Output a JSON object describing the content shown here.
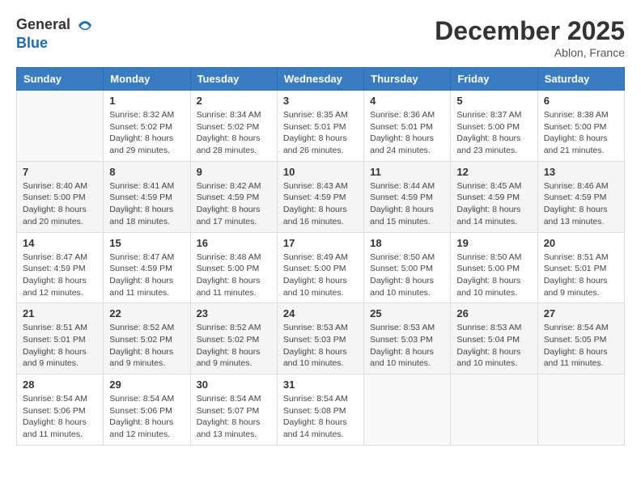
{
  "logo": {
    "general": "General",
    "blue": "Blue"
  },
  "header": {
    "month_year": "December 2025",
    "location": "Ablon, France"
  },
  "weekdays": [
    "Sunday",
    "Monday",
    "Tuesday",
    "Wednesday",
    "Thursday",
    "Friday",
    "Saturday"
  ],
  "weeks": [
    [
      {
        "day": "",
        "info": ""
      },
      {
        "day": "1",
        "info": "Sunrise: 8:32 AM\nSunset: 5:02 PM\nDaylight: 8 hours\nand 29 minutes."
      },
      {
        "day": "2",
        "info": "Sunrise: 8:34 AM\nSunset: 5:02 PM\nDaylight: 8 hours\nand 28 minutes."
      },
      {
        "day": "3",
        "info": "Sunrise: 8:35 AM\nSunset: 5:01 PM\nDaylight: 8 hours\nand 26 minutes."
      },
      {
        "day": "4",
        "info": "Sunrise: 8:36 AM\nSunset: 5:01 PM\nDaylight: 8 hours\nand 24 minutes."
      },
      {
        "day": "5",
        "info": "Sunrise: 8:37 AM\nSunset: 5:00 PM\nDaylight: 8 hours\nand 23 minutes."
      },
      {
        "day": "6",
        "info": "Sunrise: 8:38 AM\nSunset: 5:00 PM\nDaylight: 8 hours\nand 21 minutes."
      }
    ],
    [
      {
        "day": "7",
        "info": "Sunrise: 8:40 AM\nSunset: 5:00 PM\nDaylight: 8 hours\nand 20 minutes."
      },
      {
        "day": "8",
        "info": "Sunrise: 8:41 AM\nSunset: 4:59 PM\nDaylight: 8 hours\nand 18 minutes."
      },
      {
        "day": "9",
        "info": "Sunrise: 8:42 AM\nSunset: 4:59 PM\nDaylight: 8 hours\nand 17 minutes."
      },
      {
        "day": "10",
        "info": "Sunrise: 8:43 AM\nSunset: 4:59 PM\nDaylight: 8 hours\nand 16 minutes."
      },
      {
        "day": "11",
        "info": "Sunrise: 8:44 AM\nSunset: 4:59 PM\nDaylight: 8 hours\nand 15 minutes."
      },
      {
        "day": "12",
        "info": "Sunrise: 8:45 AM\nSunset: 4:59 PM\nDaylight: 8 hours\nand 14 minutes."
      },
      {
        "day": "13",
        "info": "Sunrise: 8:46 AM\nSunset: 4:59 PM\nDaylight: 8 hours\nand 13 minutes."
      }
    ],
    [
      {
        "day": "14",
        "info": "Sunrise: 8:47 AM\nSunset: 4:59 PM\nDaylight: 8 hours\nand 12 minutes."
      },
      {
        "day": "15",
        "info": "Sunrise: 8:47 AM\nSunset: 4:59 PM\nDaylight: 8 hours\nand 11 minutes."
      },
      {
        "day": "16",
        "info": "Sunrise: 8:48 AM\nSunset: 5:00 PM\nDaylight: 8 hours\nand 11 minutes."
      },
      {
        "day": "17",
        "info": "Sunrise: 8:49 AM\nSunset: 5:00 PM\nDaylight: 8 hours\nand 10 minutes."
      },
      {
        "day": "18",
        "info": "Sunrise: 8:50 AM\nSunset: 5:00 PM\nDaylight: 8 hours\nand 10 minutes."
      },
      {
        "day": "19",
        "info": "Sunrise: 8:50 AM\nSunset: 5:00 PM\nDaylight: 8 hours\nand 10 minutes."
      },
      {
        "day": "20",
        "info": "Sunrise: 8:51 AM\nSunset: 5:01 PM\nDaylight: 8 hours\nand 9 minutes."
      }
    ],
    [
      {
        "day": "21",
        "info": "Sunrise: 8:51 AM\nSunset: 5:01 PM\nDaylight: 8 hours\nand 9 minutes."
      },
      {
        "day": "22",
        "info": "Sunrise: 8:52 AM\nSunset: 5:02 PM\nDaylight: 8 hours\nand 9 minutes."
      },
      {
        "day": "23",
        "info": "Sunrise: 8:52 AM\nSunset: 5:02 PM\nDaylight: 8 hours\nand 9 minutes."
      },
      {
        "day": "24",
        "info": "Sunrise: 8:53 AM\nSunset: 5:03 PM\nDaylight: 8 hours\nand 10 minutes."
      },
      {
        "day": "25",
        "info": "Sunrise: 8:53 AM\nSunset: 5:03 PM\nDaylight: 8 hours\nand 10 minutes."
      },
      {
        "day": "26",
        "info": "Sunrise: 8:53 AM\nSunset: 5:04 PM\nDaylight: 8 hours\nand 10 minutes."
      },
      {
        "day": "27",
        "info": "Sunrise: 8:54 AM\nSunset: 5:05 PM\nDaylight: 8 hours\nand 11 minutes."
      }
    ],
    [
      {
        "day": "28",
        "info": "Sunrise: 8:54 AM\nSunset: 5:06 PM\nDaylight: 8 hours\nand 11 minutes."
      },
      {
        "day": "29",
        "info": "Sunrise: 8:54 AM\nSunset: 5:06 PM\nDaylight: 8 hours\nand 12 minutes."
      },
      {
        "day": "30",
        "info": "Sunrise: 8:54 AM\nSunset: 5:07 PM\nDaylight: 8 hours\nand 13 minutes."
      },
      {
        "day": "31",
        "info": "Sunrise: 8:54 AM\nSunset: 5:08 PM\nDaylight: 8 hours\nand 14 minutes."
      },
      {
        "day": "",
        "info": ""
      },
      {
        "day": "",
        "info": ""
      },
      {
        "day": "",
        "info": ""
      }
    ]
  ]
}
